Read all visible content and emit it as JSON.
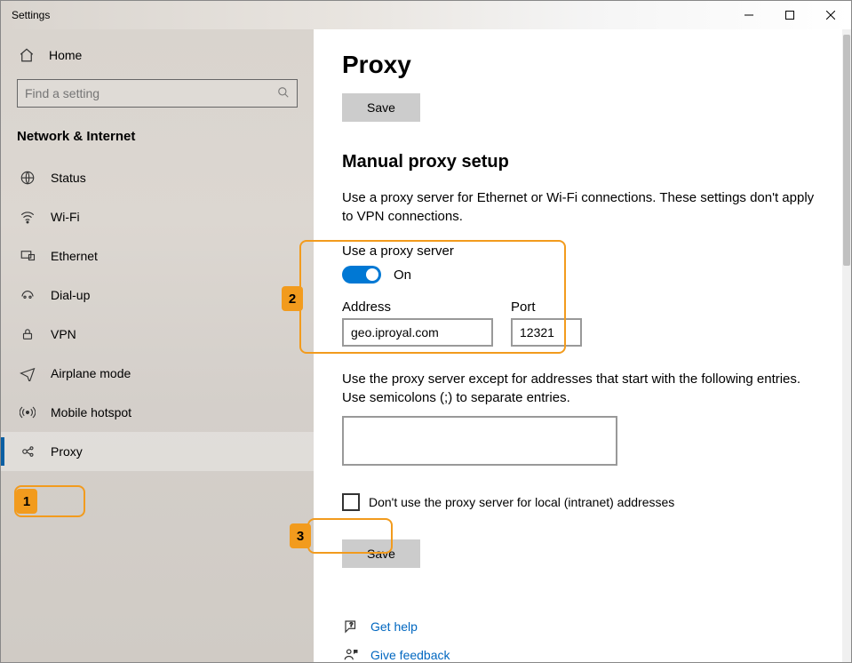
{
  "window": {
    "title": "Settings"
  },
  "sidebar": {
    "home": "Home",
    "search_placeholder": "Find a setting",
    "section": "Network & Internet",
    "items": [
      {
        "label": "Status",
        "icon": "status"
      },
      {
        "label": "Wi-Fi",
        "icon": "wifi"
      },
      {
        "label": "Ethernet",
        "icon": "ethernet"
      },
      {
        "label": "Dial-up",
        "icon": "dialup"
      },
      {
        "label": "VPN",
        "icon": "vpn"
      },
      {
        "label": "Airplane mode",
        "icon": "airplane"
      },
      {
        "label": "Mobile hotspot",
        "icon": "hotspot"
      },
      {
        "label": "Proxy",
        "icon": "proxy",
        "selected": true
      }
    ]
  },
  "main": {
    "title": "Proxy",
    "save_top": "Save",
    "section_heading": "Manual proxy setup",
    "description": "Use a proxy server for Ethernet or Wi-Fi connections. These settings don't apply to VPN connections.",
    "use_proxy_label": "Use a proxy server",
    "toggle_state": "On",
    "address_label": "Address",
    "address_value": "geo.iproyal.com",
    "port_label": "Port",
    "port_value": "12321",
    "except_desc": "Use the proxy server except for addresses that start with the following entries. Use semicolons (;) to separate entries.",
    "except_value": "",
    "local_checkbox": "Don't use the proxy server for local (intranet) addresses",
    "save_bottom": "Save",
    "get_help": "Get help",
    "give_feedback": "Give feedback"
  },
  "annotations": {
    "step1": "1",
    "step2": "2",
    "step3": "3"
  }
}
